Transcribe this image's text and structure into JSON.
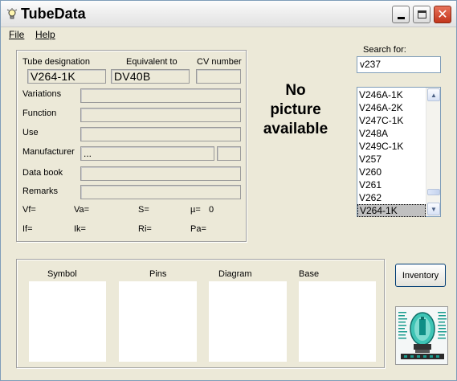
{
  "window": {
    "title": "TubeData"
  },
  "menu": {
    "file": "File",
    "help": "Help"
  },
  "labels": {
    "tube_designation": "Tube designation",
    "equivalent_to": "Equivalent to",
    "cv_number": "CV number",
    "variations": "Variations",
    "function": "Function",
    "use": "Use",
    "manufacturer": "Manufacturer",
    "data_book": "Data book",
    "remarks": "Remarks",
    "vf": "Vf=",
    "va": "Va=",
    "s": "S=",
    "mu": "µ=",
    "if": "If=",
    "ik": "Ik=",
    "ri": "Ri=",
    "pa": "Pa="
  },
  "values": {
    "tube_designation": "V264-1K",
    "equivalent_to": "DV40B",
    "cv_number": "",
    "variations": "",
    "function": "",
    "use": "",
    "manufacturer": "...",
    "manufacturer_code": "",
    "data_book": "",
    "remarks": "",
    "mu": "0"
  },
  "no_picture": {
    "line1": "No",
    "line2": "picture",
    "line3": "available"
  },
  "search": {
    "label": "Search for:",
    "value": "v237"
  },
  "tube_list": {
    "items": [
      "V246A-1K",
      "V246A-2K",
      "V247C-1K",
      "V248A",
      "V249C-1K",
      "V257",
      "V260",
      "V261",
      "V262",
      "V264-1K"
    ],
    "selected": "V264-1K"
  },
  "image_panels": {
    "symbol": "Symbol",
    "pins": "Pins",
    "diagram": "Diagram",
    "base": "Base"
  },
  "buttons": {
    "inventory": "Inventory"
  },
  "icons": {
    "app": "lightbulb-icon",
    "minimize": "minimize-icon",
    "maximize": "maximize-icon",
    "close": "close-icon",
    "scroll_up": "arrow-up-icon",
    "scroll_down": "arrow-down-icon",
    "logo": "vacuum-tube-logo"
  },
  "colors": {
    "close_button": "#c2351b",
    "selection": "#c0c0c0",
    "logo_teal": "#0f8f86"
  }
}
